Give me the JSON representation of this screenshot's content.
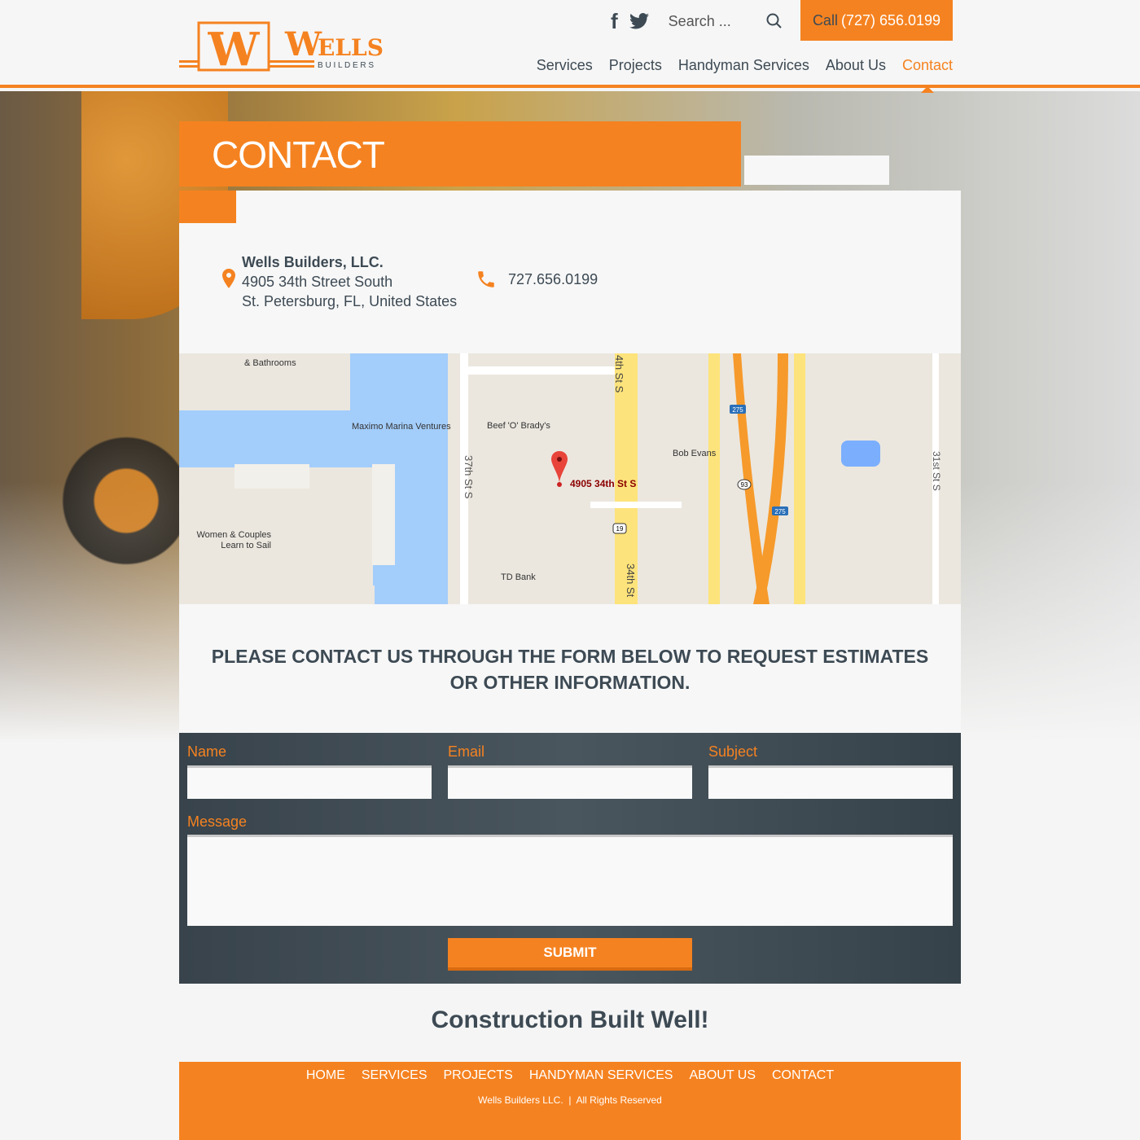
{
  "header": {
    "logo": {
      "main": "WELLS",
      "sub": "B U I L D E R S"
    },
    "search_placeholder": "Search ...",
    "call_label": "Call",
    "call_number": "(727) 656.0199",
    "nav": [
      "Services",
      "Projects",
      "Handyman Services",
      "About Us",
      "Contact"
    ],
    "active_nav": "Contact"
  },
  "page_title": "CONTACT",
  "contact": {
    "company": "Wells Builders, LLC.",
    "street": "4905 34th Street South",
    "city": "St. Petersburg, FL, United States",
    "phone": "727.656.0199"
  },
  "map": {
    "labels": {
      "kitchens": "& Bathrooms",
      "marina": "Maximo Marina Ventures",
      "beef": "Beef 'O' Brady's",
      "bob": "Bob Evans",
      "pin": "4905 34th St S",
      "sail1": "Women & Couples",
      "sail2": "Learn to Sail",
      "td": "TD Bank",
      "st37": "37th St S",
      "st34a": "4th St S",
      "st34b": "34th St",
      "st31": "31st St S",
      "i275a": "275",
      "i275b": "275",
      "r93": "93",
      "r19": "19"
    }
  },
  "cta": [
    "Please contact us through the form below to request estimates",
    "or other information."
  ],
  "form": {
    "name_label": "Name",
    "email_label": "Email",
    "subject_label": "Subject",
    "message_label": "Message",
    "submit_label": "SUBMIT"
  },
  "tagline": "Construction Built Well!",
  "footer": {
    "nav": [
      "HOME",
      "SERVICES",
      "PROJECTS",
      "HANDYMAN SERVICES",
      "ABOUT US",
      "CONTACT"
    ],
    "copyright": "Wells Builders LLC.  |  All Rights Reserved"
  },
  "colors": {
    "accent": "#f58220",
    "dark": "#3d4a54"
  }
}
